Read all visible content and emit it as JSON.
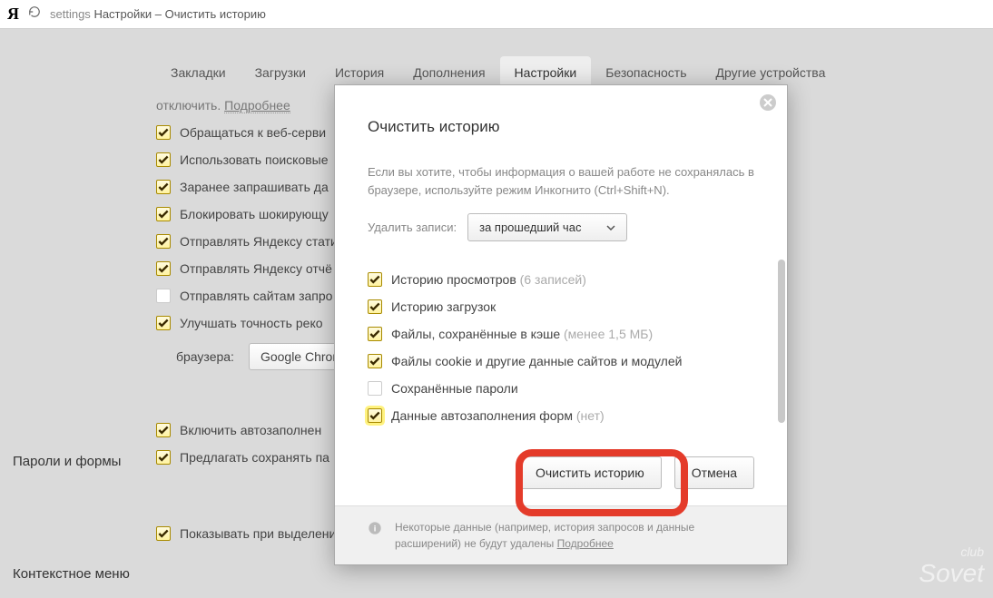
{
  "addr": {
    "proto": "settings",
    "title": "Настройки – Очистить историю"
  },
  "tabs": {
    "t0": "Закладки",
    "t1": "Загрузки",
    "t2": "История",
    "t3": "Дополнения",
    "t4": "Настройки",
    "t5": "Безопасность",
    "t6": "Другие устройства"
  },
  "bg": {
    "off": "отключить.",
    "more": "Подробнее",
    "o1": "Обращаться к веб-серви",
    "o2": "Использовать поисковые",
    "o3": "Заранее запрашивать да",
    "o4": "Блокировать шокирующу",
    "o5": "Отправлять Яндексу стати",
    "o6": "Отправлять Яндексу отчё",
    "o7": "Отправлять сайтам запро",
    "o8": "Улучшать точность реко",
    "browser_label": "браузера:",
    "browser_value": "Google Chrom",
    "s1_title": "Пароли и формы",
    "s1_o1": "Включить автозаполнен",
    "s1_o2": "Предлагать сохранять па",
    "s2_title": "Контекстное меню",
    "s2_o1": "Показывать при выделении текста кнопки «Найти» и «Копировать»"
  },
  "modal": {
    "title": "Очистить историю",
    "hint": "Если вы хотите, чтобы информация о вашей работе не сохранялась в браузере, используйте режим Инкогнито (Ctrl+Shift+N).",
    "del_label": "Удалить записи:",
    "period": "за прошедший час",
    "items": {
      "i1": "Историю просмотров",
      "i1_note": "(6 записей)",
      "i2": "Историю загрузок",
      "i3": "Файлы, сохранённые в кэше",
      "i3_note": "(менее 1,5 МБ)",
      "i4": "Файлы cookie и другие данные сайтов и модулей",
      "i5": "Сохранённые пароли",
      "i6": "Данные автозаполнения форм",
      "i6_note": "(нет)"
    },
    "btn_clear": "Очистить историю",
    "btn_cancel": "Отмена",
    "footer": "Некоторые данные (например, история запросов и данные расширений) не будут удалены",
    "footer_more": "Подробнее"
  },
  "watermark": {
    "club": "club",
    "name": "Sovet"
  }
}
